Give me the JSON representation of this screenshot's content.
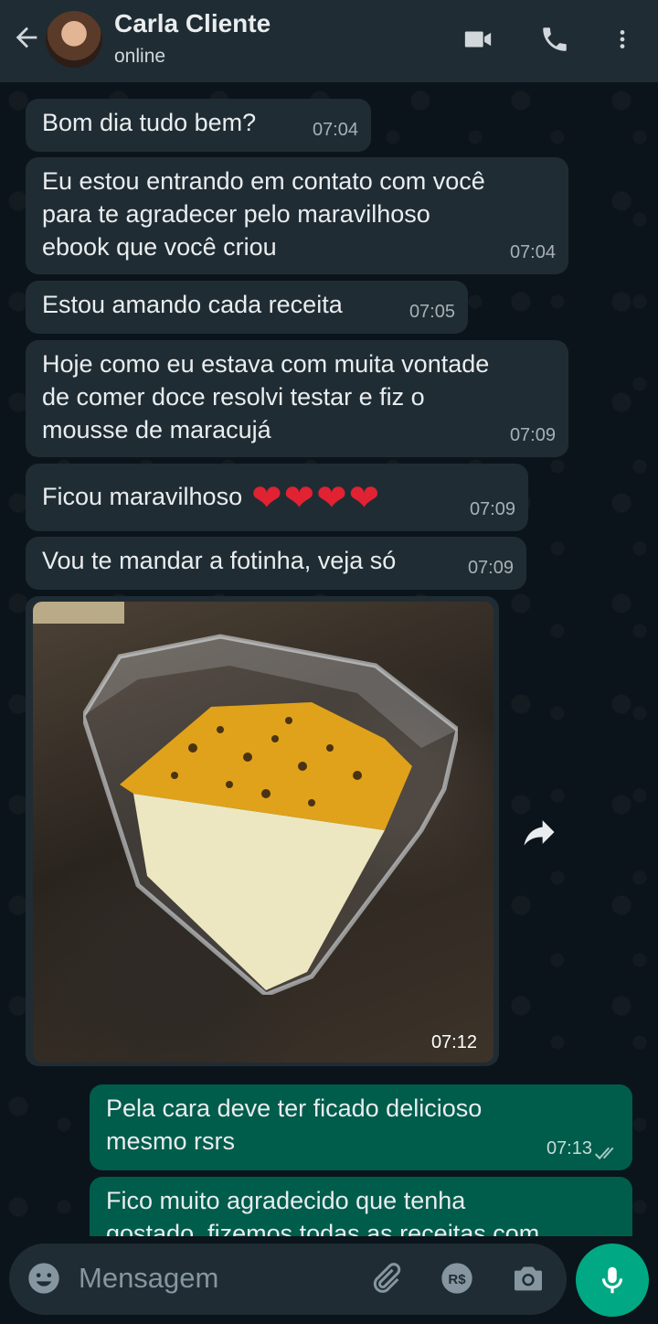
{
  "header": {
    "contact_name": "Carla Cliente",
    "status": "online"
  },
  "messages": [
    {
      "text": "Bom dia tudo bem?",
      "time": "07:04"
    },
    {
      "text": "Eu estou entrando em contato com você\npara te agradecer pelo maravilhoso\nebook que você criou",
      "time": "07:04"
    },
    {
      "text": "Estou amando cada receita",
      "time": "07:05"
    },
    {
      "text": "Hoje como eu estava com muita vontade\nde comer doce resolvi testar e fiz o\nmousse de maracujá",
      "time": "07:09"
    },
    {
      "text": "Ficou maravilhoso",
      "emoji": "❤❤❤❤",
      "time": "07:09"
    },
    {
      "text": "Vou te mandar a fotinha, veja só",
      "time": "07:09"
    },
    {
      "photo_time": "07:12"
    },
    {
      "text": "Pela cara deve ter ficado delicioso\nmesmo rsrs",
      "time": "07:13"
    },
    {
      "text": "Fico muito agradecido que tenha\ngostado, fizemos todas as receitas com"
    }
  ],
  "input": {
    "placeholder": "Mensagem"
  },
  "colors": {
    "incoming": "#202c33",
    "outgoing": "#005c4b",
    "accent": "#00a884"
  }
}
